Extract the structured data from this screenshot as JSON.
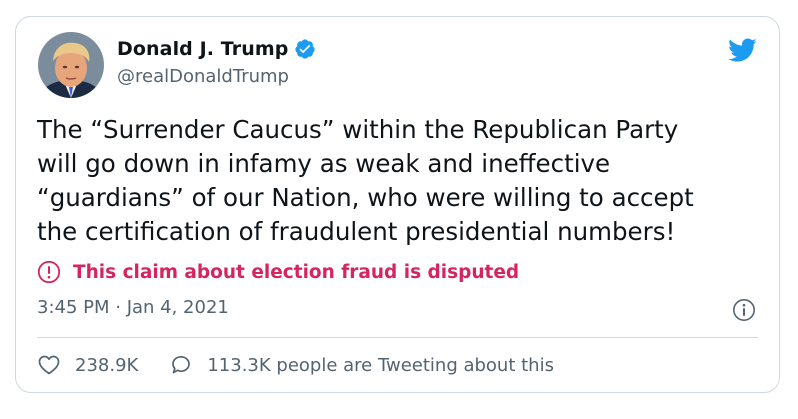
{
  "tweet": {
    "author_name": "Donald J. Trump",
    "handle": "@realDonaldTrump",
    "text": "The “Surrender Caucus” within the Republican Party\nwill go down in infamy as weak and ineffective\n“guardians” of our Nation, who were willing to accept\nthe certification of fraudulent presidential numbers!",
    "disputed_label": "This claim about election fraud is disputed",
    "timestamp": "3:45 PM · Jan 4, 2021",
    "likes": "238.9K",
    "tweeting_about": "113.3K people are Tweeting about this"
  },
  "colors": {
    "accent": "#1d9bf0",
    "disputed": "#d62462",
    "secondary_text": "#536471",
    "border": "#cfd9de"
  },
  "icons": {
    "avatar": "avatar",
    "verified": "verified-badge-icon",
    "brand": "twitter-bird-icon",
    "disputed": "exclamation-circle-icon",
    "info": "info-icon",
    "like": "heart-icon",
    "reply": "speech-bubble-icon"
  }
}
